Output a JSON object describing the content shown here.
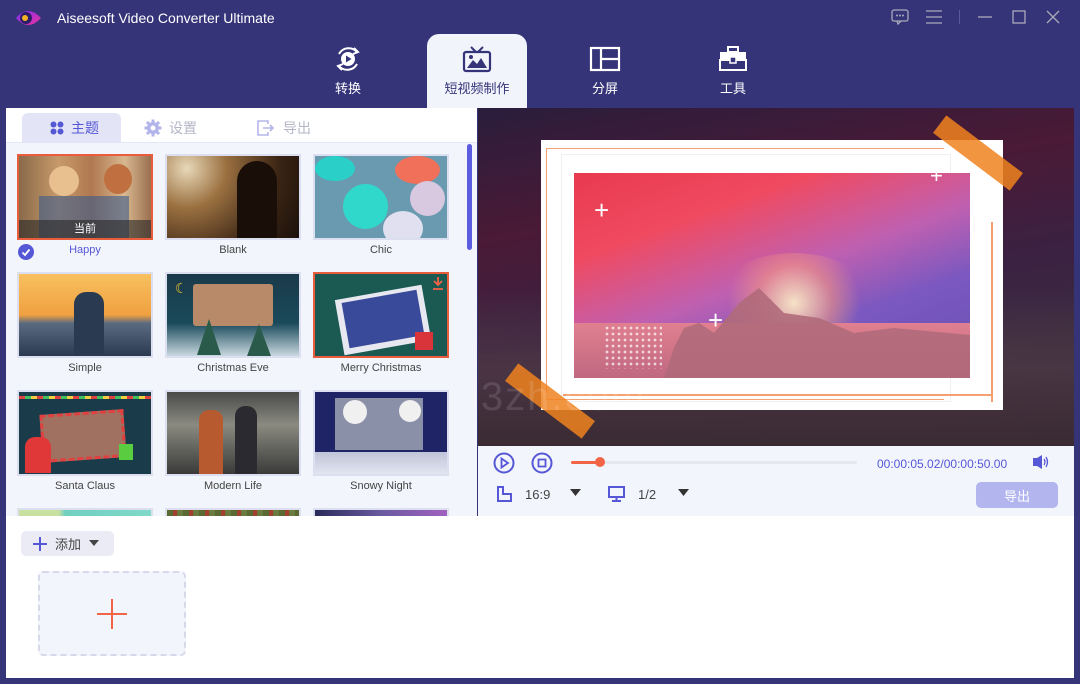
{
  "app": {
    "title": "Aiseesoft Video Converter Ultimate"
  },
  "window_controls": [
    "feedback-icon",
    "menu-icon",
    "minimize-icon",
    "maximize-icon",
    "close-icon"
  ],
  "nav_tabs": [
    {
      "label": "转换",
      "icon": "convert-icon",
      "active": false
    },
    {
      "label": "短视频制作",
      "icon": "mv-icon",
      "active": true
    },
    {
      "label": "分屏",
      "icon": "collage-icon",
      "active": false
    },
    {
      "label": "工具",
      "icon": "toolbox-icon",
      "active": false
    }
  ],
  "sub_tabs": [
    {
      "label": "主题",
      "icon": "theme-icon",
      "active": true
    },
    {
      "label": "设置",
      "icon": "settings-icon",
      "active": false
    },
    {
      "label": "导出",
      "icon": "export-icon",
      "active": false
    }
  ],
  "themes": [
    {
      "name": "Happy",
      "selected": true,
      "current_label": "当前"
    },
    {
      "name": "Blank",
      "selected": false
    },
    {
      "name": "Chic",
      "selected": false
    },
    {
      "name": "Simple",
      "selected": false
    },
    {
      "name": "Christmas Eve",
      "selected": false
    },
    {
      "name": "Merry Christmas",
      "selected": false,
      "download": true
    },
    {
      "name": "Santa Claus",
      "selected": false
    },
    {
      "name": "Modern Life",
      "selected": false
    },
    {
      "name": "Snowy Night",
      "selected": false
    }
  ],
  "player": {
    "current_time": "00:00:05.02",
    "total_time": "00:00:50.00",
    "time_display": "00:00:05.02/00:00:50.00",
    "progress_fraction": 0.1,
    "aspect_ratio": "16:9",
    "screen_ratio": "1/2",
    "export_label": "导出"
  },
  "bottom": {
    "add_label": "添加"
  },
  "colors": {
    "brand": "#353479",
    "accent": "#5557d6",
    "highlight": "#ea5d3c"
  },
  "watermark": "i3zh.com"
}
